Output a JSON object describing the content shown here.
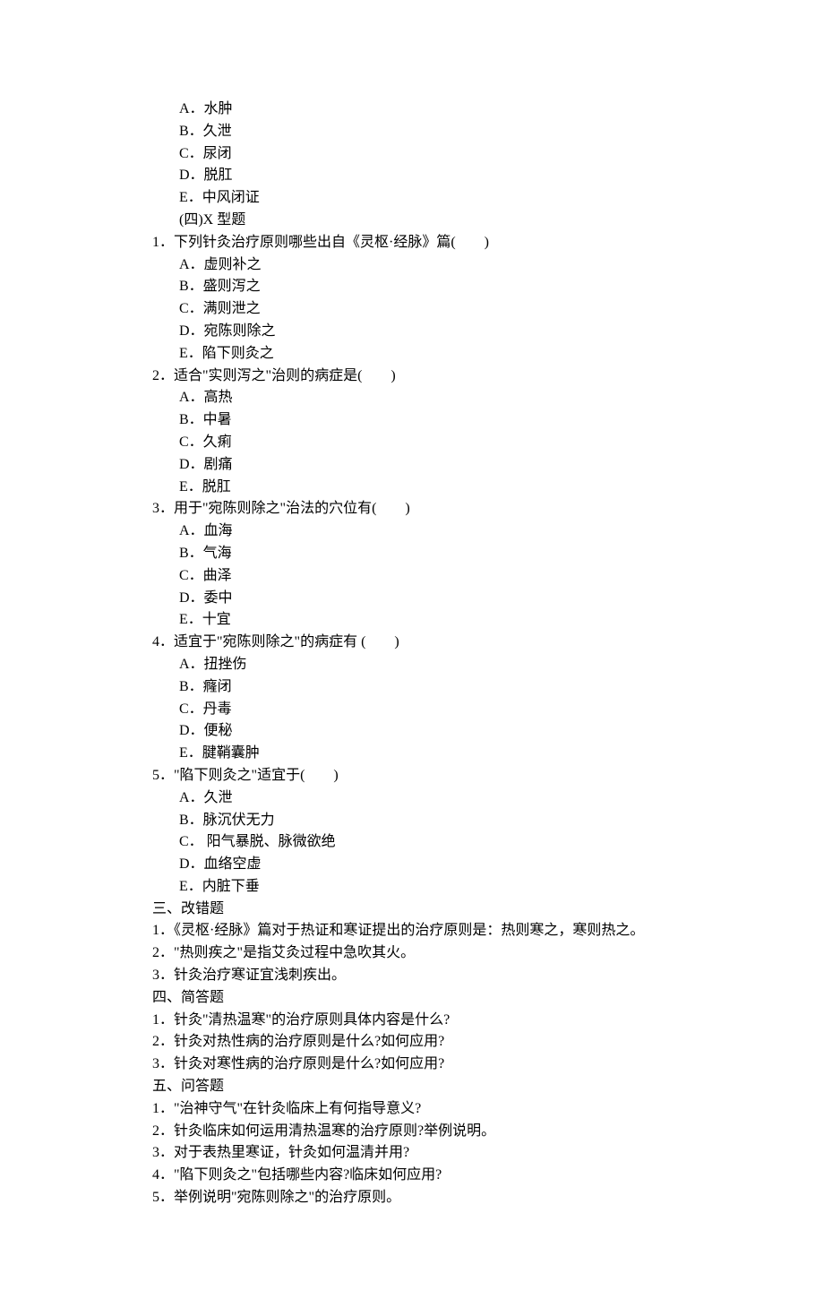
{
  "prev_options": [
    "A．水肿",
    "B．久泄",
    "C．尿闭",
    "D．脱肛",
    "E．中风闭证"
  ],
  "x_section_label": "(四)X 型题",
  "x_questions": [
    {
      "stem": "1．下列针灸治疗原则哪些出自《灵枢·经脉》篇(　　)",
      "options": [
        "A．虚则补之",
        "B．盛则泻之",
        "C．满则泄之",
        "D．宛陈则除之",
        "E．陷下则灸之"
      ]
    },
    {
      "stem": "2．适合\"实则泻之\"治则的病症是(　　)",
      "options": [
        "A．高热",
        "B．中暑",
        "C．久痢",
        "D．剧痛",
        "E．脱肛"
      ]
    },
    {
      "stem": "3．用于\"宛陈则除之\"治法的穴位有(　　)",
      "options": [
        "A．血海",
        "B．气海",
        "C．曲泽",
        "D．委中",
        "E．十宜"
      ]
    },
    {
      "stem": "4．适宜于\"宛陈则除之\"的病症有 (　　)",
      "options": [
        "A．扭挫伤",
        "B．癃闭",
        "C．丹毒",
        "D．便秘",
        "E．腱鞘囊肿"
      ]
    },
    {
      "stem": "5．\"陷下则灸之\"适宜于(　　)",
      "options": [
        "A．久泄",
        "B．脉沉伏无力",
        "C．  阳气暴脱、脉微欲绝",
        "D．血络空虚",
        "E．内脏下垂"
      ]
    }
  ],
  "section3": {
    "heading": "三、改错题",
    "items": [
      "1．《灵枢·经脉》篇对于热证和寒证提出的治疗原则是：热则寒之，寒则热之。",
      "2．\"热则疾之\"是指艾灸过程中急吹其火。",
      "3．针灸治疗寒证宜浅刺疾出。"
    ]
  },
  "section4": {
    "heading": "四、简答题",
    "items": [
      "1．针灸\"清热温寒\"的治疗原则具体内容是什么?",
      "2．针灸对热性病的治疗原则是什么?如何应用?",
      "3．针灸对寒性病的治疗原则是什么?如何应用?"
    ]
  },
  "section5": {
    "heading": "五、问答题",
    "items": [
      "1．\"治神守气\"在针灸临床上有何指导意义?",
      "2．针灸临床如何运用清热温寒的治疗原则?举例说明。",
      "3．对于表热里寒证，针灸如何温清并用?",
      "4．\"陷下则灸之\"包括哪些内容?临床如何应用?",
      "5．举例说明\"宛陈则除之\"的治疗原则。"
    ]
  }
}
